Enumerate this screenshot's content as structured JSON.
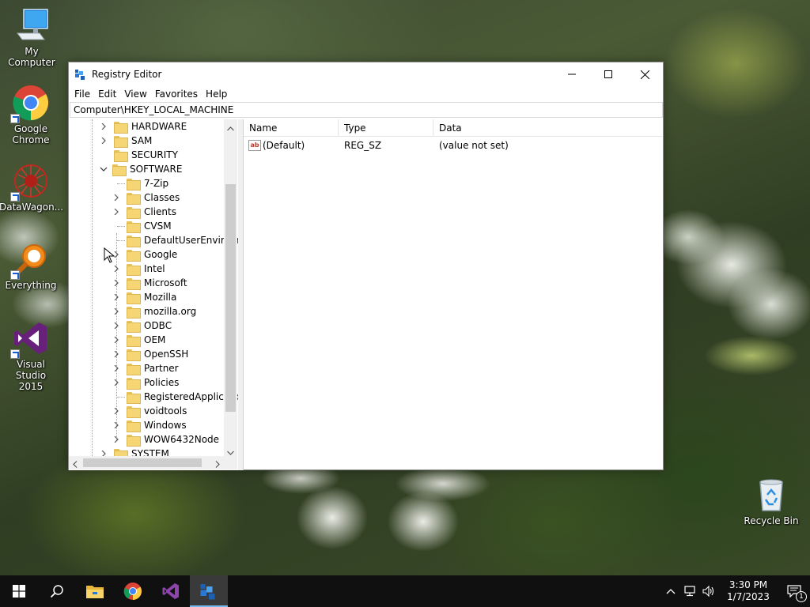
{
  "desktop": {
    "icons": [
      {
        "label": "My Computer"
      },
      {
        "label": "Google Chrome"
      },
      {
        "label": "DataWagon..."
      },
      {
        "label": "Everything"
      },
      {
        "label": "Visual Studio 2015"
      },
      {
        "label": "Recycle Bin"
      }
    ]
  },
  "window": {
    "title": "Registry Editor",
    "menu": [
      "File",
      "Edit",
      "View",
      "Favorites",
      "Help"
    ],
    "address": "Computer\\HKEY_LOCAL_MACHINE"
  },
  "tree": {
    "top_level": [
      {
        "label": "HARDWARE",
        "expander": "collapsed"
      },
      {
        "label": "SAM",
        "expander": "collapsed"
      },
      {
        "label": "SECURITY",
        "expander": "none"
      },
      {
        "label": "SOFTWARE",
        "expander": "expanded"
      }
    ],
    "software_children": [
      {
        "label": "7-Zip",
        "expander": "none"
      },
      {
        "label": "Classes",
        "expander": "collapsed"
      },
      {
        "label": "Clients",
        "expander": "collapsed"
      },
      {
        "label": "CVSM",
        "expander": "none"
      },
      {
        "label": "DefaultUserEnvironn",
        "expander": "none"
      },
      {
        "label": "Google",
        "expander": "collapsed"
      },
      {
        "label": "Intel",
        "expander": "collapsed"
      },
      {
        "label": "Microsoft",
        "expander": "collapsed"
      },
      {
        "label": "Mozilla",
        "expander": "collapsed"
      },
      {
        "label": "mozilla.org",
        "expander": "collapsed"
      },
      {
        "label": "ODBC",
        "expander": "collapsed"
      },
      {
        "label": "OEM",
        "expander": "collapsed"
      },
      {
        "label": "OpenSSH",
        "expander": "collapsed"
      },
      {
        "label": "Partner",
        "expander": "collapsed"
      },
      {
        "label": "Policies",
        "expander": "collapsed"
      },
      {
        "label": "RegisteredApplicatic",
        "expander": "none"
      },
      {
        "label": "voidtools",
        "expander": "collapsed"
      },
      {
        "label": "Windows",
        "expander": "collapsed"
      },
      {
        "label": "WOW6432Node",
        "expander": "collapsed"
      }
    ],
    "after": [
      {
        "label": "SYSTEM",
        "expander": "collapsed"
      }
    ]
  },
  "list": {
    "columns": [
      "Name",
      "Type",
      "Data"
    ],
    "rows": [
      {
        "name": "(Default)",
        "type": "REG_SZ",
        "data": "(value not set)",
        "icon": "ab"
      }
    ]
  },
  "taskbar": {
    "time": "3:30 PM",
    "date": "1/7/2023",
    "notification_count": "1",
    "apps": [
      "start-icon",
      "search-icon",
      "file-explorer-icon",
      "chrome-icon",
      "visual-studio-icon",
      "registry-editor-icon"
    ]
  },
  "colors": {
    "accent": "#76b9ed",
    "taskbar": "#101010",
    "folder": "#f6d674"
  }
}
